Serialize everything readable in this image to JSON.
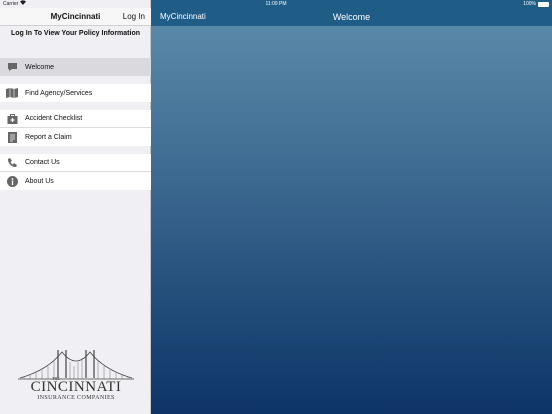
{
  "status_bar": {
    "carrier": "Carrier",
    "time": "11:09 PM",
    "battery": "100%",
    "battery_level": 1.0
  },
  "sidebar": {
    "title": "MyCincinnati",
    "login_label": "Log In",
    "policy_link": "Log In To View Your Policy Information",
    "groups": [
      [
        {
          "label": "Welcome",
          "icon": "speech-bubble-icon",
          "selected": true
        }
      ],
      [
        {
          "label": "Find Agency/Services",
          "icon": "map-icon"
        }
      ],
      [
        {
          "label": "Accident Checklist",
          "icon": "first-aid-kit-icon"
        },
        {
          "label": "Report a Claim",
          "icon": "clipboard-icon"
        }
      ],
      [
        {
          "label": "Contact Us",
          "icon": "phone-icon"
        },
        {
          "label": "About Us",
          "icon": "info-icon"
        }
      ]
    ],
    "logo": {
      "the": "THE",
      "name": "CINCINNATI",
      "subtitle": "INSURANCE COMPANIES"
    }
  },
  "main": {
    "back_label": "MyCincinnati",
    "title": "Welcome"
  },
  "colors": {
    "nav_blue": "#1f5d87",
    "gradient_top": "#5e8dac",
    "gradient_bottom": "#0e3466",
    "sidebar_bg": "#efeff4",
    "selected_row": "#d9d9de"
  }
}
